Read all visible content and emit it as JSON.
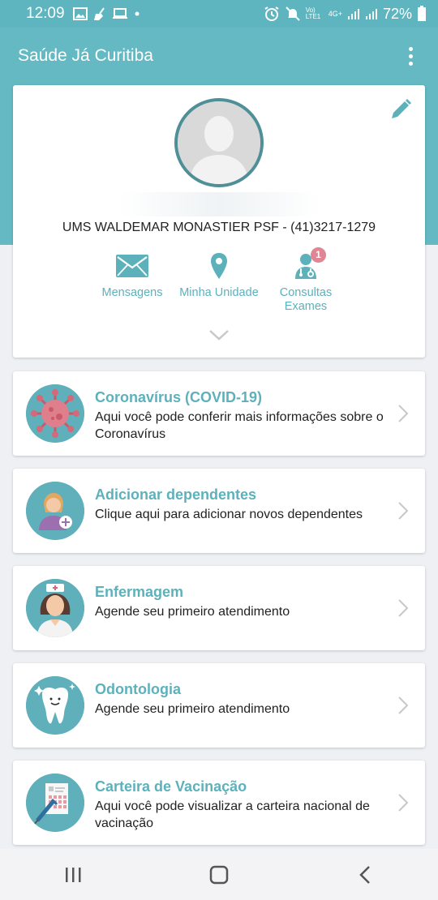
{
  "status_bar": {
    "time": "12:09",
    "left_icons": [
      "image-icon",
      "broom-icon",
      "laptop-icon",
      "dot-icon"
    ],
    "right_icons": [
      "alarm-icon",
      "mute-icon",
      "volte-icon",
      "4g-icon",
      "signal-icon",
      "signal-icon",
      "battery-icon"
    ],
    "network": "Vo) LTE1",
    "network_type": "4G+",
    "battery": "72%"
  },
  "app_bar": {
    "title": "Saúde Já Curitiba",
    "menu_icon": "more-vert-icon"
  },
  "profile": {
    "edit_icon": "pencil-icon",
    "avatar_icon": "person-silhouette-icon",
    "unit_line": "UMS WALDEMAR MONASTIER PSF - (41)3217-1279",
    "actions": [
      {
        "label": "Mensagens",
        "icon": "envelope-icon"
      },
      {
        "label": "Minha Unidade",
        "icon": "map-pin-icon"
      },
      {
        "label": "Consultas Exames",
        "line1": "Consultas",
        "line2": "Exames",
        "icon": "doctor-icon",
        "badge": "1"
      }
    ],
    "expand_icon": "chevron-down-icon"
  },
  "cards": [
    {
      "title": "Coronavírus (COVID-19)",
      "description": "Aqui você pode conferir mais informações sobre o Coronavírus",
      "icon": "virus-icon"
    },
    {
      "title": "Adicionar dependentes",
      "description": "Clique aqui para adicionar novos dependentes",
      "icon": "add-person-icon"
    },
    {
      "title": "Enfermagem",
      "description": "Agende seu primeiro atendimento",
      "icon": "nurse-icon"
    },
    {
      "title": "Odontologia",
      "description": "Agende seu primeiro atendimento",
      "icon": "tooth-icon"
    },
    {
      "title": "Carteira de Vacinação",
      "description": "Aqui você pode visualizar a carteira nacional de vacinação",
      "icon": "vaccine-card-icon"
    }
  ],
  "nav_bar": {
    "recents_icon": "recents-icon",
    "home_icon": "home-icon",
    "back_icon": "back-icon"
  },
  "colors": {
    "primary": "#64b9c3",
    "accent_text": "#5cb1bb",
    "badge": "#e08593",
    "background": "#eef0f4"
  }
}
